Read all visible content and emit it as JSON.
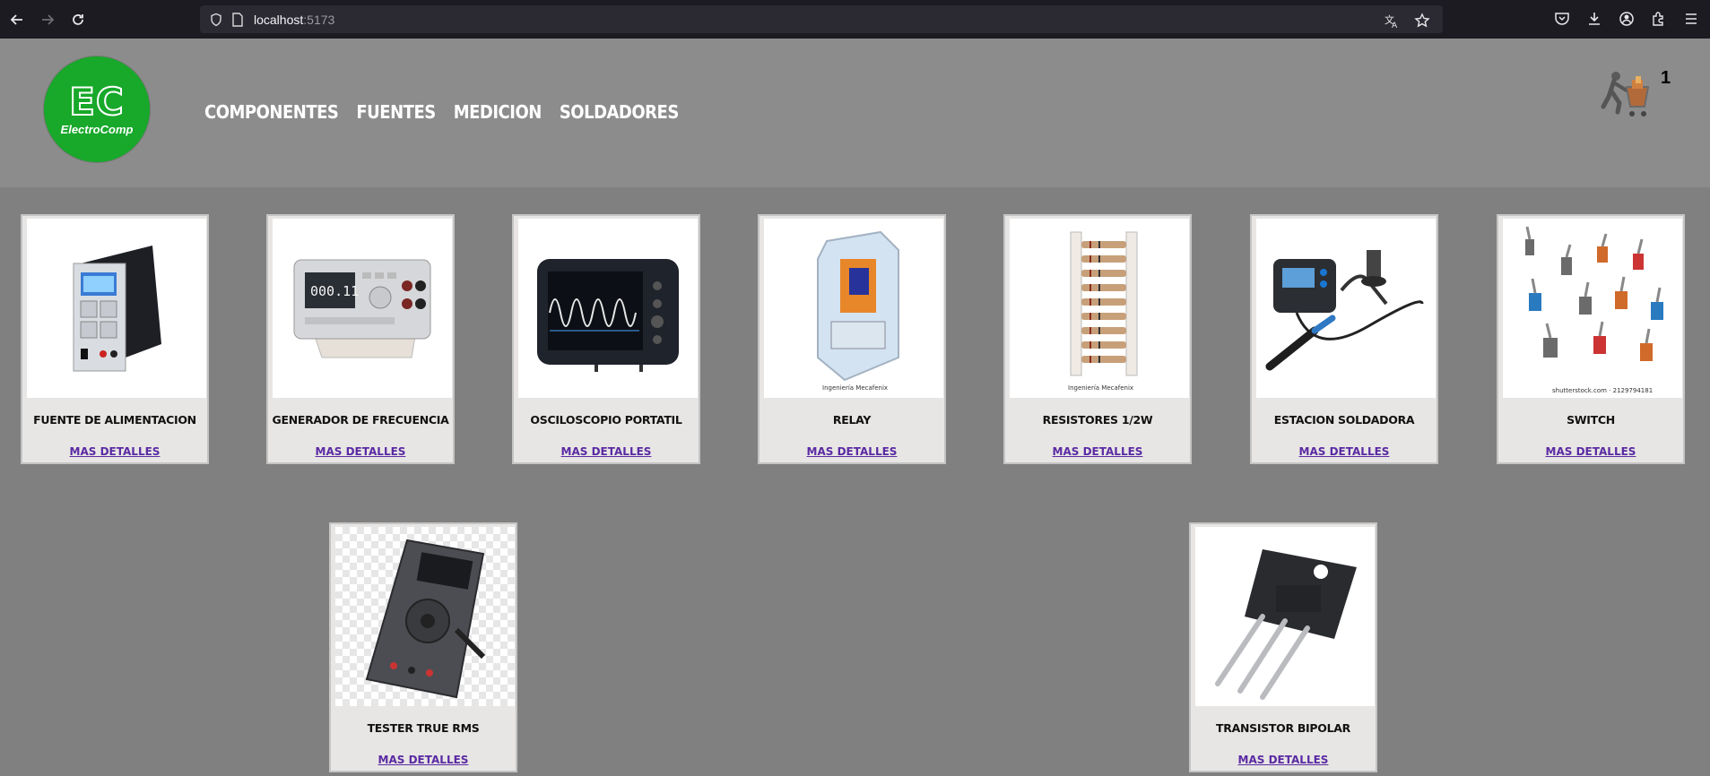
{
  "browser": {
    "url_host": "localhost",
    "url_port": ":5173"
  },
  "site": {
    "logo_main": "EC",
    "logo_sub": "ElectroComp",
    "nav": [
      "COMPONENTES",
      "FUENTES",
      "MEDICION",
      "SOLDADORES"
    ],
    "cart_count": "1"
  },
  "products": [
    {
      "name": "FUENTE DE ALIMENTACION",
      "link": "MAS DETALLES",
      "image": "power-supply"
    },
    {
      "name": "GENERADOR DE FRECUENCIA",
      "link": "MAS DETALLES",
      "image": "frequency-generator"
    },
    {
      "name": "OSCILOSCOPIO PORTATIL",
      "link": "MAS DETALLES",
      "image": "oscilloscope"
    },
    {
      "name": "RELAY",
      "link": "MAS DETALLES",
      "image": "relay",
      "caption": "Ingeniería Mecafenix"
    },
    {
      "name": "RESISTORES 1/2W",
      "link": "MAS DETALLES",
      "image": "resistors",
      "caption": "Ingeniería Mecafenix"
    },
    {
      "name": "ESTACION SOLDADORA",
      "link": "MAS DETALLES",
      "image": "soldering-station"
    },
    {
      "name": "SWITCH",
      "link": "MAS DETALLES",
      "image": "switches",
      "caption": "shutterstock.com · 2129794181"
    },
    {
      "name": "TESTER TRUE RMS",
      "link": "MAS DETALLES",
      "image": "multimeter"
    },
    {
      "name": "TRANSISTOR BIPOLAR",
      "link": "MAS DETALLES",
      "image": "transistor"
    }
  ]
}
